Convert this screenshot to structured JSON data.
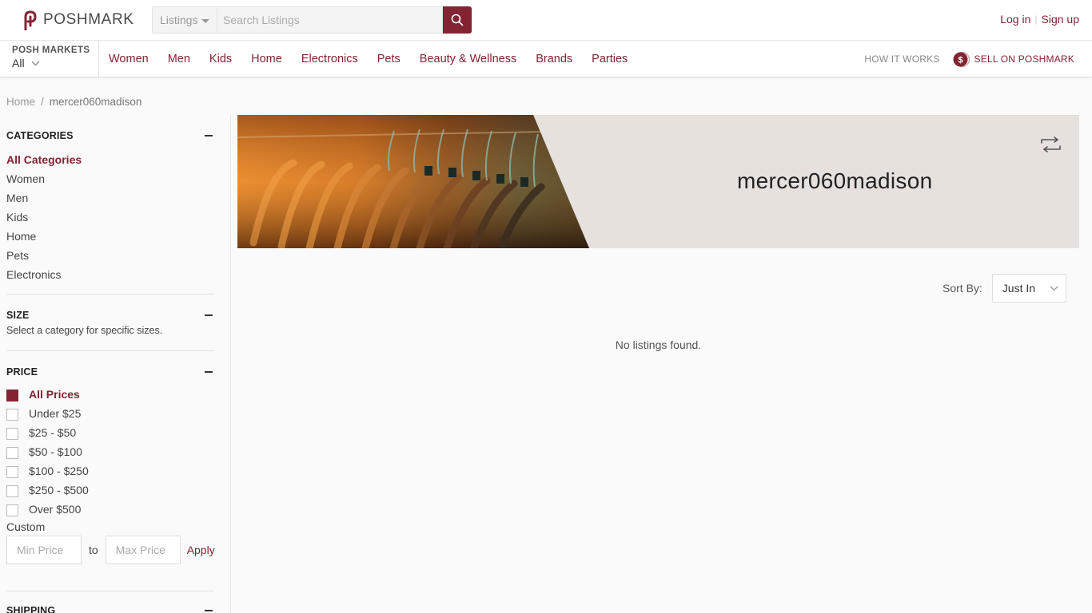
{
  "brand": {
    "name": "POSHMARK",
    "accent": "#822432"
  },
  "search": {
    "scope": "Listings",
    "placeholder": "Search Listings",
    "icon": "search-icon"
  },
  "auth": {
    "login": "Log in",
    "signup": "Sign up"
  },
  "markets": {
    "label": "POSH MARKETS",
    "value": "All"
  },
  "nav": {
    "links": [
      "Women",
      "Men",
      "Kids",
      "Home",
      "Electronics",
      "Pets",
      "Beauty & Wellness",
      "Brands",
      "Parties"
    ],
    "how_it_works": "HOW IT WORKS",
    "sell": "SELL ON POSHMARK"
  },
  "breadcrumb": {
    "home": "Home",
    "current": "mercer060madison"
  },
  "sidebar": {
    "categories": {
      "title": "CATEGORIES",
      "items": [
        "All Categories",
        "Women",
        "Men",
        "Kids",
        "Home",
        "Pets",
        "Electronics"
      ],
      "active": "All Categories"
    },
    "size": {
      "title": "SIZE",
      "note": "Select a category for specific sizes."
    },
    "price": {
      "title": "PRICE",
      "items": [
        "All Prices",
        "Under $25",
        "$25 - $50",
        "$50 - $100",
        "$100 - $250",
        "$250 - $500",
        "Over $500"
      ],
      "active": "All Prices",
      "custom_label": "Custom",
      "min_placeholder": "Min Price",
      "to": "to",
      "max_placeholder": "Max Price",
      "apply": "Apply"
    },
    "shipping": {
      "title": "SHIPPING"
    }
  },
  "closet": {
    "username": "mercer060madison"
  },
  "sort": {
    "label": "Sort By:",
    "value": "Just In"
  },
  "listings": {
    "empty_message": "No listings found."
  }
}
